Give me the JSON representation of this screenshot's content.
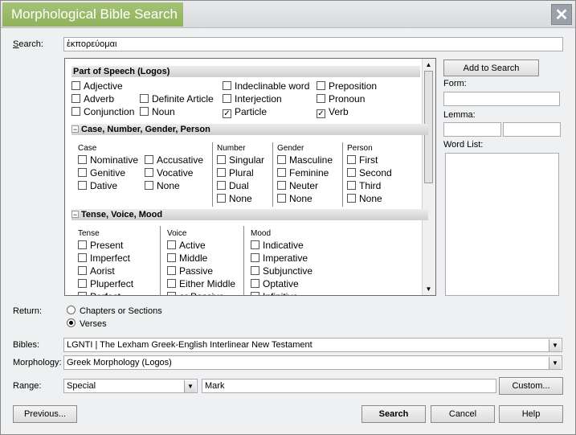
{
  "window": {
    "title": "Morphological Bible Search",
    "close_glyph": "✕"
  },
  "search": {
    "label": "Search:",
    "value": "ἐκπορεύομαι"
  },
  "right_panel": {
    "add_to_search": "Add to Search",
    "form_label": "Form:",
    "lemma_label": "Lemma:",
    "word_list_label": "Word List:"
  },
  "part_of_speech": {
    "header": "Part of Speech (Logos)",
    "items": [
      {
        "label": "Adjective",
        "checked": false
      },
      {
        "label": "Indeclinable word",
        "checked": false
      },
      {
        "label": "Preposition",
        "checked": false
      },
      {
        "label": "Adverb",
        "checked": false
      },
      {
        "label": "Definite Article",
        "checked": false
      },
      {
        "label": "Interjection",
        "checked": false
      },
      {
        "label": "Pronoun",
        "checked": false
      },
      {
        "label": "Conjunction",
        "checked": false
      },
      {
        "label": "Noun",
        "checked": false
      },
      {
        "label": "Particle",
        "checked": true
      },
      {
        "label": "Verb",
        "checked": true
      }
    ]
  },
  "case_section": {
    "header": "Case, Number, Gender, Person",
    "case": {
      "title": "Case",
      "items": [
        "Nominative",
        "Accusative",
        "Genitive",
        "Vocative",
        "Dative",
        "None"
      ]
    },
    "number": {
      "title": "Number",
      "items": [
        "Singular",
        "Plural",
        "Dual",
        "None"
      ]
    },
    "gender": {
      "title": "Gender",
      "items": [
        "Masculine",
        "Feminine",
        "Neuter",
        "None"
      ]
    },
    "person": {
      "title": "Person",
      "items": [
        "First",
        "Second",
        "Third",
        "None"
      ]
    }
  },
  "tense_section": {
    "header": "Tense, Voice, Mood",
    "tense": {
      "title": "Tense",
      "items": [
        "Present",
        "Imperfect",
        "Aorist",
        "Pluperfect",
        "Perfect"
      ]
    },
    "voice": {
      "title": "Voice",
      "items": [
        "Active",
        "Middle",
        "Passive",
        "Either Middle",
        "or Passive"
      ]
    },
    "mood": {
      "title": "Mood",
      "items": [
        "Indicative",
        "Imperative",
        "Subjunctive",
        "Optative",
        "Infinitive"
      ]
    }
  },
  "return": {
    "label": "Return:",
    "options": [
      "Chapters or Sections",
      "Verses"
    ],
    "selected": "Verses"
  },
  "bibles": {
    "label": "Bibles:",
    "value": "LGNTI | The Lexham Greek-English Interlinear New Testament"
  },
  "morphology": {
    "label": "Morphology:",
    "value": "Greek Morphology (Logos)"
  },
  "range": {
    "label": "Range:",
    "select_value": "Special",
    "text_value": "Mark",
    "custom_button": "Custom..."
  },
  "buttons": {
    "previous": "Previous...",
    "search": "Search",
    "cancel": "Cancel",
    "help": "Help"
  }
}
